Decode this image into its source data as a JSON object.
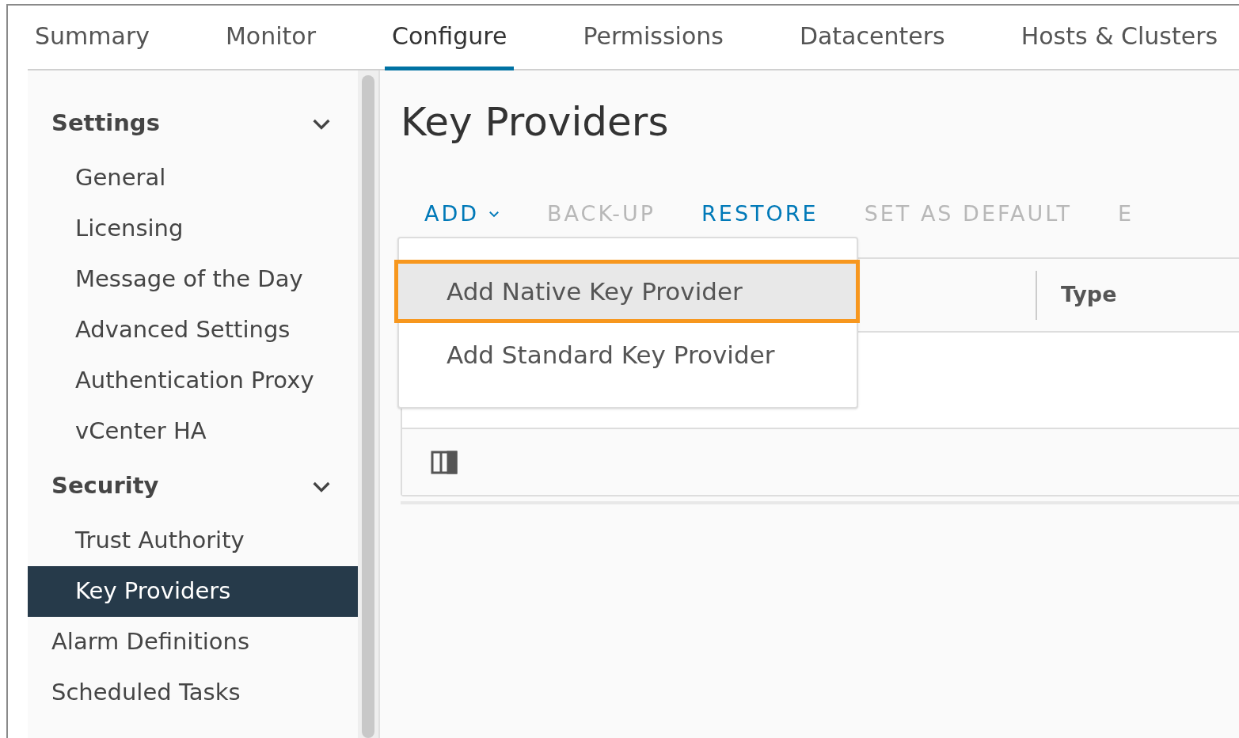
{
  "tabs": [
    {
      "label": "Summary",
      "selected": false
    },
    {
      "label": "Monitor",
      "selected": false
    },
    {
      "label": "Configure",
      "selected": true
    },
    {
      "label": "Permissions",
      "selected": false
    },
    {
      "label": "Datacenters",
      "selected": false
    },
    {
      "label": "Hosts & Clusters",
      "selected": false
    }
  ],
  "sidebar": {
    "items": [
      {
        "kind": "section",
        "label": "Settings",
        "expanded": true,
        "children": [
          {
            "label": "General",
            "selected": false
          },
          {
            "label": "Licensing",
            "selected": false
          },
          {
            "label": "Message of the Day",
            "selected": false
          },
          {
            "label": "Advanced Settings",
            "selected": false
          },
          {
            "label": "Authentication Proxy",
            "selected": false
          },
          {
            "label": "vCenter HA",
            "selected": false
          }
        ]
      },
      {
        "kind": "section",
        "label": "Security",
        "expanded": true,
        "children": [
          {
            "label": "Trust Authority",
            "selected": false
          },
          {
            "label": "Key Providers",
            "selected": true
          }
        ]
      },
      {
        "kind": "item",
        "label": "Alarm Definitions",
        "selected": false
      },
      {
        "kind": "item",
        "label": "Scheduled Tasks",
        "selected": false
      }
    ]
  },
  "page": {
    "title": "Key Providers"
  },
  "toolbar": [
    {
      "label": "ADD",
      "disabled": false,
      "dropdown": true
    },
    {
      "label": "BACK-UP",
      "disabled": true,
      "dropdown": false
    },
    {
      "label": "RESTORE",
      "disabled": false,
      "dropdown": false
    },
    {
      "label": "SET AS DEFAULT",
      "disabled": true,
      "dropdown": false
    },
    {
      "label": "E",
      "disabled": true,
      "dropdown": false
    }
  ],
  "add_menu": {
    "open": true,
    "items": [
      {
        "label": "Add Native Key Provider",
        "selected": true
      },
      {
        "label": "Add Standard Key Provider",
        "selected": false
      }
    ]
  },
  "table": {
    "columns": [
      "Type"
    ]
  }
}
